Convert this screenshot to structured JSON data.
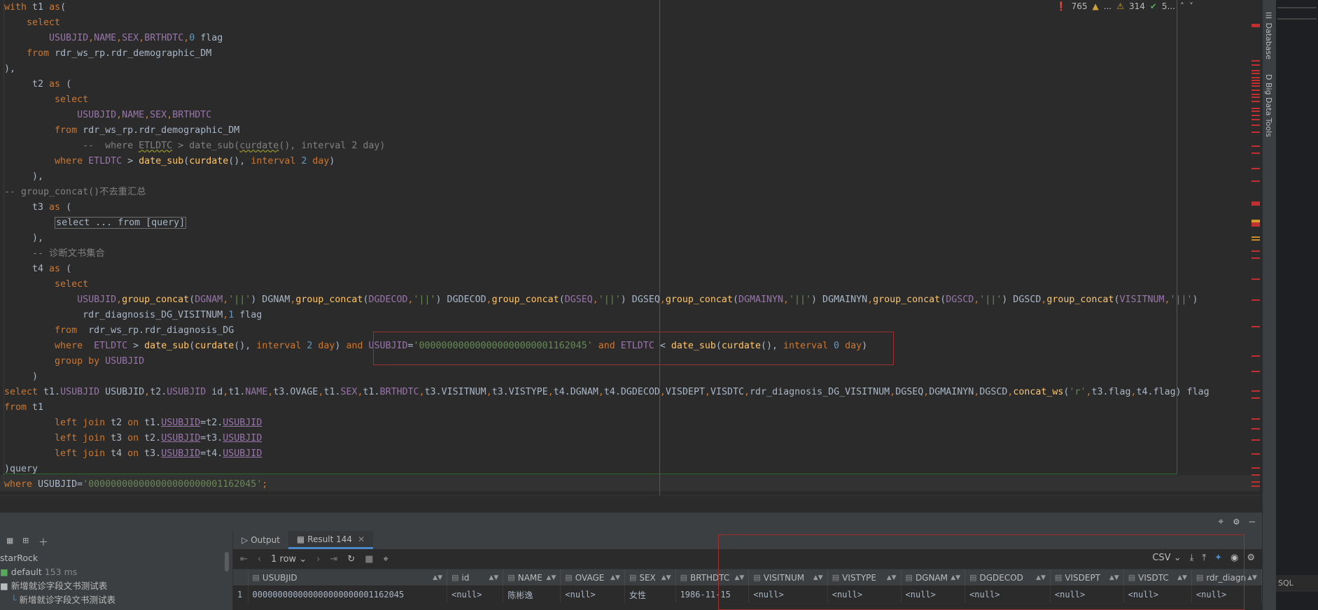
{
  "editor": {
    "lines": [
      [
        [
          "kw",
          "with "
        ],
        [
          "",
          "t1 "
        ],
        [
          "kw",
          "as"
        ],
        [
          "",
          "("
        ]
      ],
      [
        [
          "kw",
          "    select"
        ]
      ],
      [
        [
          "fld",
          "        USUBJID"
        ],
        [
          "kw",
          ","
        ],
        [
          "fld",
          "NAME"
        ],
        [
          "kw",
          ","
        ],
        [
          "fld",
          "SEX"
        ],
        [
          "kw",
          ","
        ],
        [
          "fld",
          "BRTHDTC"
        ],
        [
          "kw",
          ","
        ],
        [
          "num",
          "0"
        ],
        [
          "",
          " flag"
        ]
      ],
      [
        [
          "kw",
          "    from "
        ],
        [
          "",
          "rdr_ws_rp.rdr_demographic_DM"
        ]
      ],
      [
        [
          "",
          "),"
        ]
      ],
      [
        [
          "",
          "     t2 "
        ],
        [
          "kw",
          "as"
        ],
        [
          "",
          " ("
        ]
      ],
      [
        [
          "kw",
          "         select"
        ]
      ],
      [
        [
          "fld",
          "             USUBJID"
        ],
        [
          "kw",
          ","
        ],
        [
          "fld",
          "NAME"
        ],
        [
          "kw",
          ","
        ],
        [
          "fld",
          "SEX"
        ],
        [
          "kw",
          ","
        ],
        [
          "fld",
          "BRTHDTC"
        ]
      ],
      [
        [
          "kw",
          "         from "
        ],
        [
          "",
          "rdr_ws_rp.rdr_demographic_DM"
        ]
      ],
      [
        [
          "cmt",
          "              --  where "
        ],
        [
          "cmt squig",
          "ETLDTC"
        ],
        [
          "cmt",
          " > date_sub("
        ],
        [
          "cmt squig",
          "curdate"
        ],
        [
          "cmt",
          "(), interval 2 day)"
        ]
      ],
      [
        [
          "kw",
          "         where "
        ],
        [
          "fld",
          "ETLDTC"
        ],
        [
          "",
          " > "
        ],
        [
          "fn",
          "date_sub"
        ],
        [
          "",
          "("
        ],
        [
          "fn",
          "curdate"
        ],
        [
          "",
          "(), "
        ],
        [
          "kw",
          "interval "
        ],
        [
          "num",
          "2 "
        ],
        [
          "kw",
          "day"
        ],
        [
          "",
          ")"
        ]
      ],
      [
        [
          "",
          "     ),"
        ]
      ],
      [
        [
          "cmt",
          "-- group_concat()不去重汇总"
        ]
      ],
      [
        [
          "",
          "     t3 "
        ],
        [
          "kw",
          "as"
        ],
        [
          "",
          " ("
        ]
      ],
      [
        [
          "",
          "         "
        ],
        [
          "fold",
          "select ... from [query]"
        ]
      ],
      [
        [
          "",
          "     ),"
        ]
      ],
      [
        [
          "cmt",
          "     -- 诊断文书集合"
        ]
      ],
      [
        [
          "",
          "     t4 "
        ],
        [
          "kw",
          "as"
        ],
        [
          "",
          " ("
        ]
      ],
      [
        [
          "kw",
          "         select"
        ]
      ],
      [
        [
          "fld",
          "             USUBJID"
        ],
        [
          "kw",
          ","
        ],
        [
          "fn",
          "group_concat"
        ],
        [
          "",
          "("
        ],
        [
          "fld",
          "DGNAM"
        ],
        [
          "kw",
          ","
        ],
        [
          "str",
          "'||'"
        ],
        [
          "",
          ") DGNAM"
        ],
        [
          "kw",
          ","
        ],
        [
          "fn",
          "group_concat"
        ],
        [
          "",
          "("
        ],
        [
          "fld",
          "DGDECOD"
        ],
        [
          "kw",
          ","
        ],
        [
          "str",
          "'||'"
        ],
        [
          "",
          ") DGDECOD"
        ],
        [
          "kw",
          ","
        ],
        [
          "fn",
          "group_concat"
        ],
        [
          "",
          "("
        ],
        [
          "fld",
          "DGSEQ"
        ],
        [
          "kw",
          ","
        ],
        [
          "str",
          "'||'"
        ],
        [
          "",
          ") DGSEQ"
        ],
        [
          "kw",
          ","
        ],
        [
          "fn",
          "group_concat"
        ],
        [
          "",
          "("
        ],
        [
          "fld",
          "DGMAINYN"
        ],
        [
          "kw",
          ","
        ],
        [
          "str",
          "'||'"
        ],
        [
          "",
          ") DGMAINYN"
        ],
        [
          "kw",
          ","
        ],
        [
          "fn",
          "group_concat"
        ],
        [
          "",
          "("
        ],
        [
          "fld",
          "DGSCD"
        ],
        [
          "kw",
          ","
        ],
        [
          "str",
          "'||'"
        ],
        [
          "",
          ") DGSCD"
        ],
        [
          "kw",
          ","
        ],
        [
          "fn",
          "group_concat"
        ],
        [
          "",
          "("
        ],
        [
          "fld",
          "VISITNUM"
        ],
        [
          "kw",
          ","
        ],
        [
          "str",
          "'||'"
        ],
        [
          "",
          ")"
        ]
      ],
      [
        [
          "",
          "              rdr_diagnosis_DG_VISITNUM"
        ],
        [
          "kw",
          ","
        ],
        [
          "num",
          "1"
        ],
        [
          "",
          " flag"
        ]
      ],
      [
        [
          "kw",
          "         from  "
        ],
        [
          "",
          "rdr_ws_rp.rdr_diagnosis_DG"
        ]
      ],
      [
        [
          "kw",
          "         where  "
        ],
        [
          "fld",
          "ETLDTC"
        ],
        [
          "",
          " > "
        ],
        [
          "fn",
          "date_sub"
        ],
        [
          "",
          "("
        ],
        [
          "fn",
          "curdate"
        ],
        [
          "",
          "(), "
        ],
        [
          "kw",
          "interval "
        ],
        [
          "num",
          "2 "
        ],
        [
          "kw",
          "day"
        ],
        [
          "",
          ") "
        ],
        [
          "kw",
          "and "
        ],
        [
          "fld",
          "USUBJID"
        ],
        [
          "",
          "="
        ],
        [
          "str",
          "'000000000000000000000001162045'"
        ],
        [
          "",
          " "
        ],
        [
          "kw",
          "and "
        ],
        [
          "fld",
          "ETLDTC"
        ],
        [
          "",
          " < "
        ],
        [
          "fn",
          "date_sub"
        ],
        [
          "",
          "("
        ],
        [
          "fn",
          "curdate"
        ],
        [
          "",
          "(), "
        ],
        [
          "kw",
          "interval "
        ],
        [
          "num",
          "0 "
        ],
        [
          "kw",
          "day"
        ],
        [
          "",
          ")"
        ]
      ],
      [
        [
          "kw",
          "         group by "
        ],
        [
          "fld",
          "USUBJID"
        ]
      ],
      [
        [
          "",
          "     )"
        ]
      ],
      [
        [
          "kw",
          "select "
        ],
        [
          "",
          "t1."
        ],
        [
          "fld",
          "USUBJID"
        ],
        [
          "",
          " USUBJID"
        ],
        [
          "kw",
          ","
        ],
        [
          "",
          "t2."
        ],
        [
          "fld",
          "USUBJID"
        ],
        [
          "",
          " id"
        ],
        [
          "kw",
          ","
        ],
        [
          "",
          "t1."
        ],
        [
          "fld",
          "NAME"
        ],
        [
          "kw",
          ","
        ],
        [
          "",
          "t3.OVAGE"
        ],
        [
          "kw",
          ","
        ],
        [
          "",
          "t1."
        ],
        [
          "fld",
          "SEX"
        ],
        [
          "kw",
          ","
        ],
        [
          "",
          "t1."
        ],
        [
          "fld",
          "BRTHDTC"
        ],
        [
          "kw",
          ","
        ],
        [
          "",
          "t3.VISITNUM"
        ],
        [
          "kw",
          ","
        ],
        [
          "",
          "t3.VISTYPE"
        ],
        [
          "kw",
          ","
        ],
        [
          "",
          "t4.DGNAM"
        ],
        [
          "kw",
          ","
        ],
        [
          "",
          "t4.DGDECOD"
        ],
        [
          "kw",
          ","
        ],
        [
          "",
          "VISDEPT"
        ],
        [
          "kw",
          ","
        ],
        [
          "",
          "VISDTC"
        ],
        [
          "kw",
          ","
        ],
        [
          "",
          "rdr_diagnosis_DG_VISITNUM"
        ],
        [
          "kw",
          ","
        ],
        [
          "",
          "DGSEQ"
        ],
        [
          "kw",
          ","
        ],
        [
          "",
          "DGMAINYN"
        ],
        [
          "kw",
          ","
        ],
        [
          "",
          "DGSCD"
        ],
        [
          "kw",
          ","
        ],
        [
          "fn",
          "concat_ws"
        ],
        [
          "",
          "("
        ],
        [
          "str",
          "'r'"
        ],
        [
          "kw",
          ","
        ],
        [
          "",
          "t3.flag"
        ],
        [
          "kw",
          ","
        ],
        [
          "",
          "t4.flag) flag"
        ]
      ],
      [
        [
          "kw",
          "from "
        ],
        [
          "",
          "t1"
        ]
      ],
      [
        [
          "kw",
          "         left join "
        ],
        [
          "",
          "t2 "
        ],
        [
          "kw",
          "on "
        ],
        [
          "",
          "t1."
        ],
        [
          "fld ul",
          "USUBJID"
        ],
        [
          "",
          "=t2."
        ],
        [
          "fld ul",
          "USUBJID"
        ]
      ],
      [
        [
          "kw",
          "         left join "
        ],
        [
          "",
          "t3 "
        ],
        [
          "kw",
          "on "
        ],
        [
          "",
          "t2."
        ],
        [
          "fld ul",
          "USUBJID"
        ],
        [
          "",
          "=t3."
        ],
        [
          "fld ul",
          "USUBJID"
        ]
      ],
      [
        [
          "kw",
          "         left join "
        ],
        [
          "",
          "t4 "
        ],
        [
          "kw",
          "on "
        ],
        [
          "",
          "t3."
        ],
        [
          "fld ul",
          "USUBJID"
        ],
        [
          "",
          "=t4."
        ],
        [
          "fld ul",
          "USUBJID"
        ]
      ],
      [
        [
          "",
          ")query"
        ]
      ],
      [
        [
          "kw",
          "where "
        ],
        [
          "",
          "USUBJID="
        ],
        [
          "str",
          "'000000000000000000000001162045'"
        ],
        [
          "kw",
          ";"
        ]
      ]
    ]
  },
  "inspections": {
    "errors": "765",
    "weak_warnings": "...",
    "warnings": "314",
    "ok": "5..."
  },
  "right_tabs": {
    "database": "Database",
    "bigdata": "Big Data Tools"
  },
  "far_panel": {
    "label": "SQL"
  },
  "services": {
    "tree": [
      {
        "label": "starRock",
        "extra": ""
      },
      {
        "label": "default",
        "extra": "153 ms"
      },
      {
        "label": "新增就诊字段文书测试表",
        "extra": ""
      },
      {
        "label": "新增就诊字段文书测试表",
        "extra": ""
      }
    ],
    "tabs": [
      {
        "label": "Output"
      },
      {
        "label": "Result 144"
      }
    ],
    "rows_label": "1 row",
    "export_format": "CSV"
  },
  "table": {
    "columns": [
      "USUBJID",
      "id",
      "NAME",
      "OVAGE",
      "SEX",
      "BRTHDTC",
      "VISITNUM",
      "VISTYPE",
      "DGNAM",
      "DGDECOD",
      "VISDEPT",
      "VISDTC",
      "rdr_diagn"
    ],
    "rows": [
      {
        "num": "1",
        "cells": [
          "000000000000000000000001162045",
          "<null>",
          "陈彬逸",
          "<null>",
          "女性",
          "1986-11-15",
          "<null>",
          "<null>",
          "<null>",
          "<null>",
          "<null>",
          "<null>",
          "<null>"
        ]
      }
    ]
  }
}
